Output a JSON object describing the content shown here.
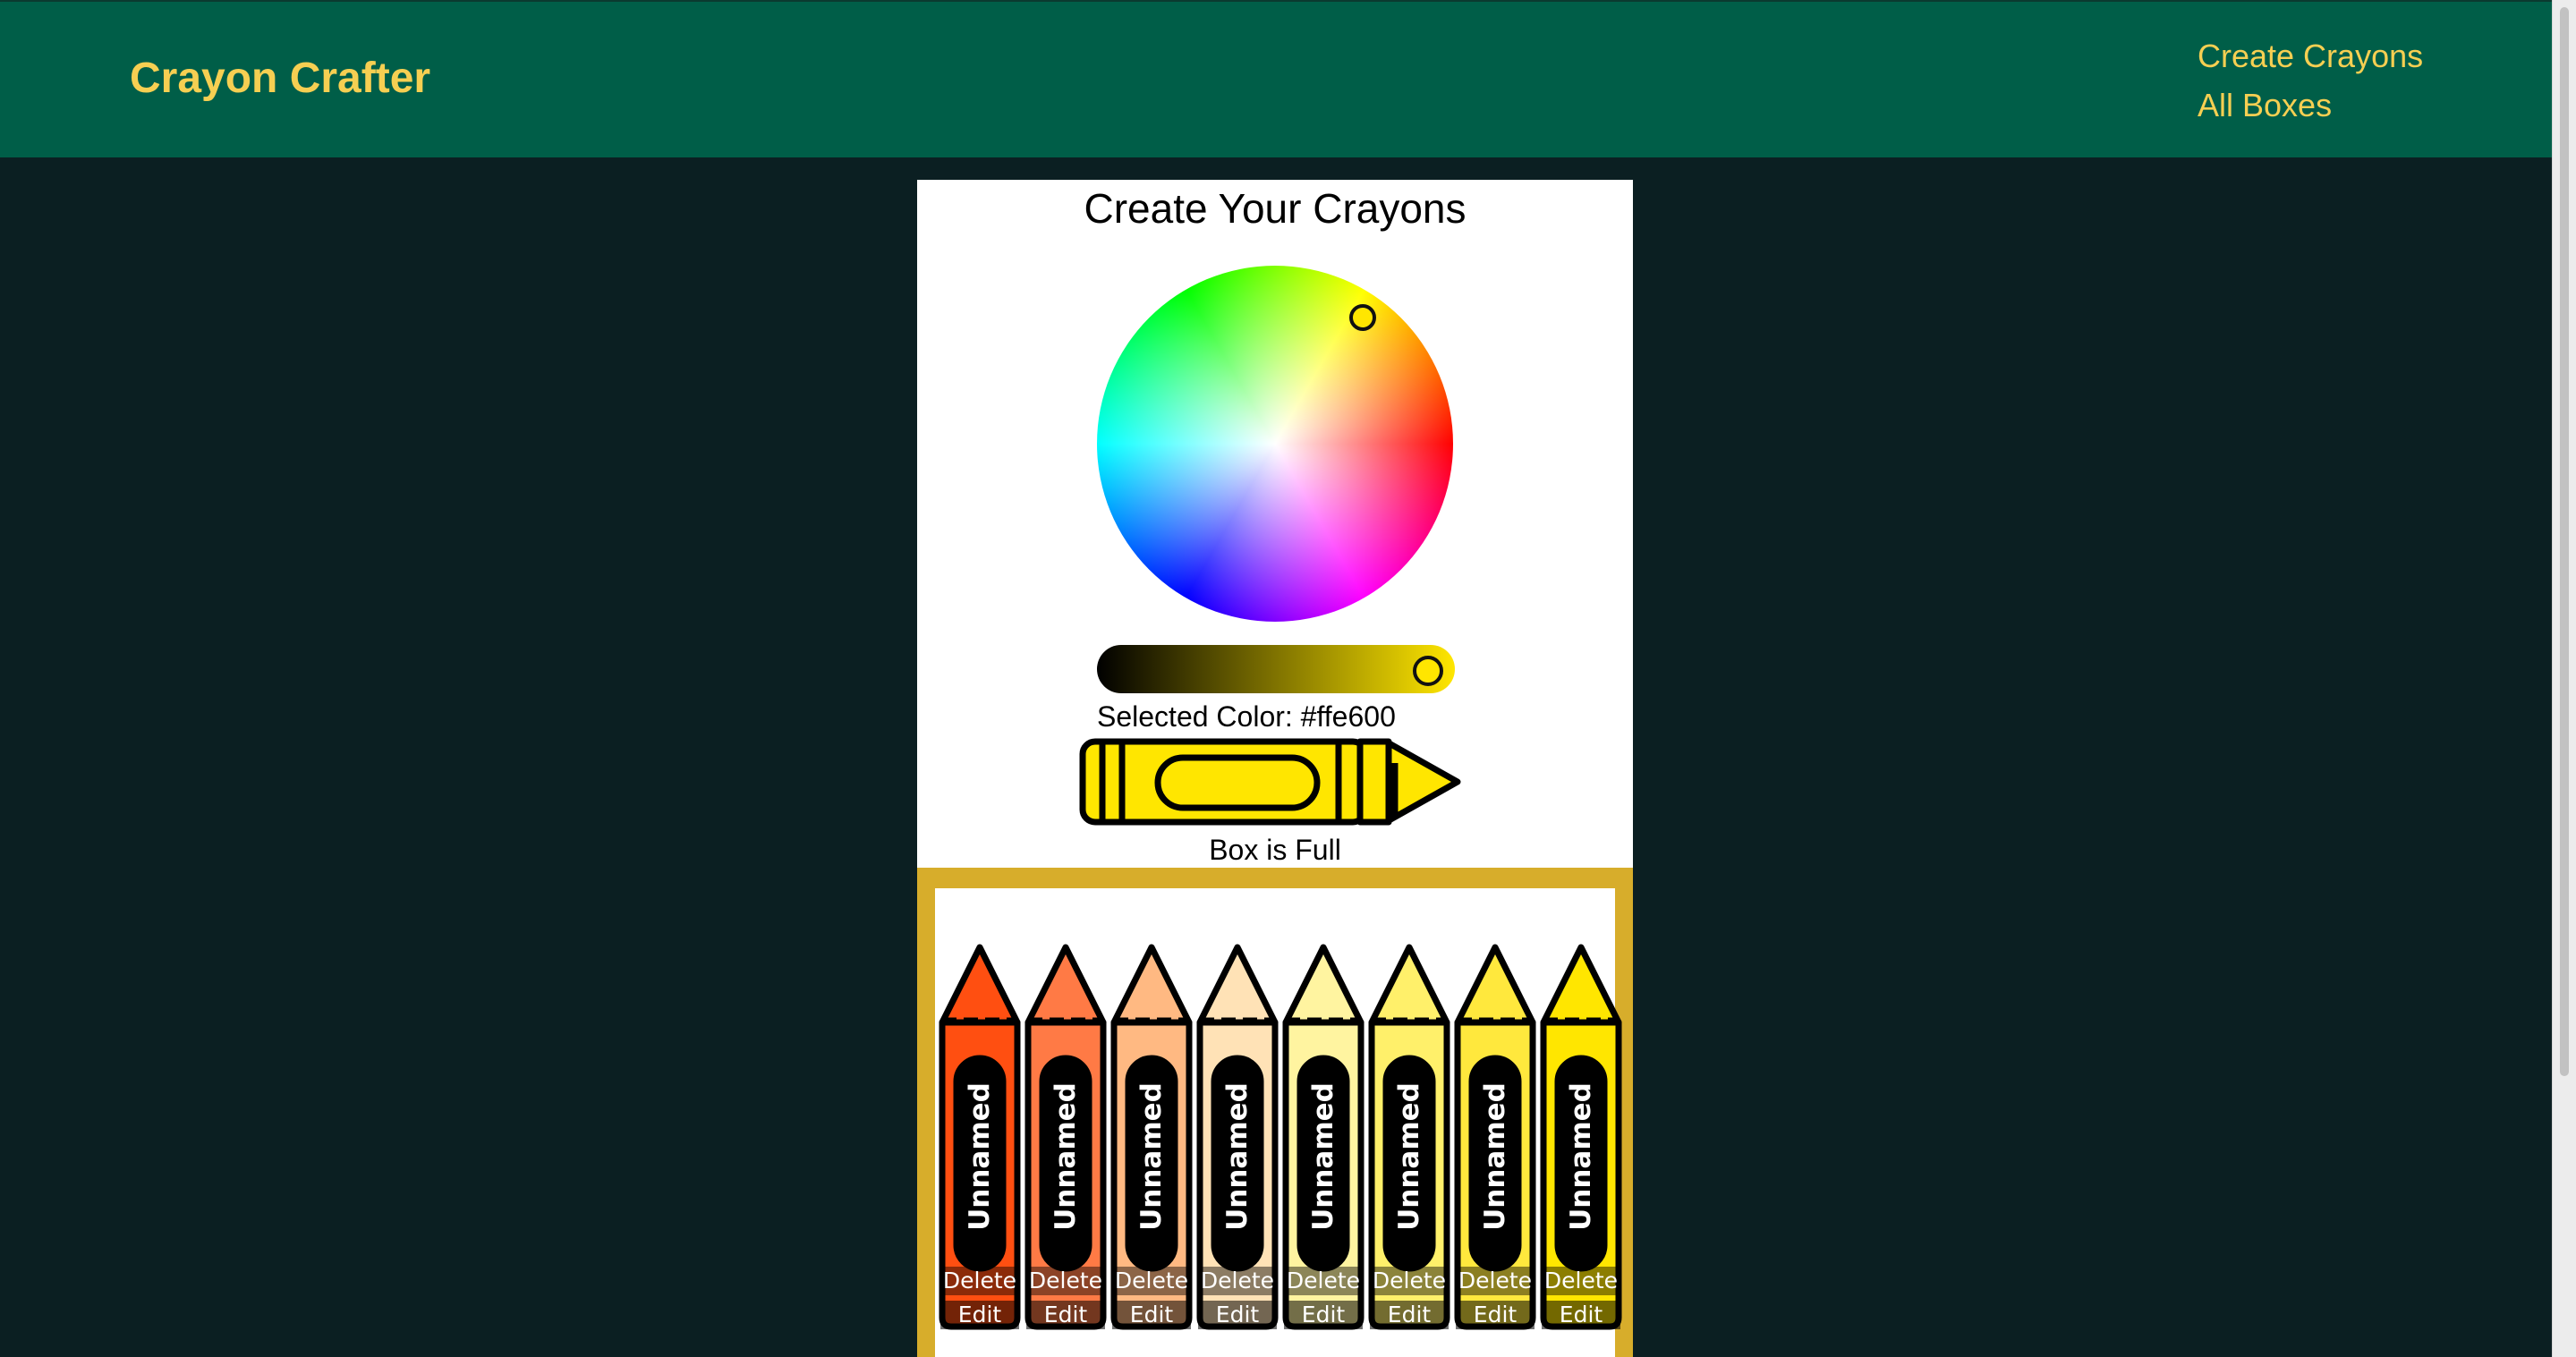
{
  "header": {
    "brand": "Crayon Crafter",
    "nav": [
      {
        "label": "Create Crayons"
      },
      {
        "label": "All Boxes"
      }
    ],
    "background_color": "#005e48",
    "text_color": "#f6cf52"
  },
  "creator": {
    "title": "Create Your Crayons",
    "selected_color_label": "Selected Color: #ffe600",
    "selected_color": "#ffe600",
    "box_status": "Box is Full"
  },
  "box": {
    "frame_color": "#d7ad2b",
    "crayons": [
      {
        "name": "Unnamed",
        "color": "#ff4f11",
        "delete_label": "Delete",
        "edit_label": "Edit"
      },
      {
        "name": "Unnamed",
        "color": "#ff7a45",
        "delete_label": "Delete",
        "edit_label": "Edit"
      },
      {
        "name": "Unnamed",
        "color": "#ffb982",
        "delete_label": "Delete",
        "edit_label": "Edit"
      },
      {
        "name": "Unnamed",
        "color": "#ffe2b6",
        "delete_label": "Delete",
        "edit_label": "Edit"
      },
      {
        "name": "Unnamed",
        "color": "#fff4a0",
        "delete_label": "Delete",
        "edit_label": "Edit"
      },
      {
        "name": "Unnamed",
        "color": "#fff06a",
        "delete_label": "Delete",
        "edit_label": "Edit"
      },
      {
        "name": "Unnamed",
        "color": "#ffe83d",
        "delete_label": "Delete",
        "edit_label": "Edit"
      },
      {
        "name": "Unnamed",
        "color": "#ffe600",
        "delete_label": "Delete",
        "edit_label": "Edit"
      }
    ]
  }
}
